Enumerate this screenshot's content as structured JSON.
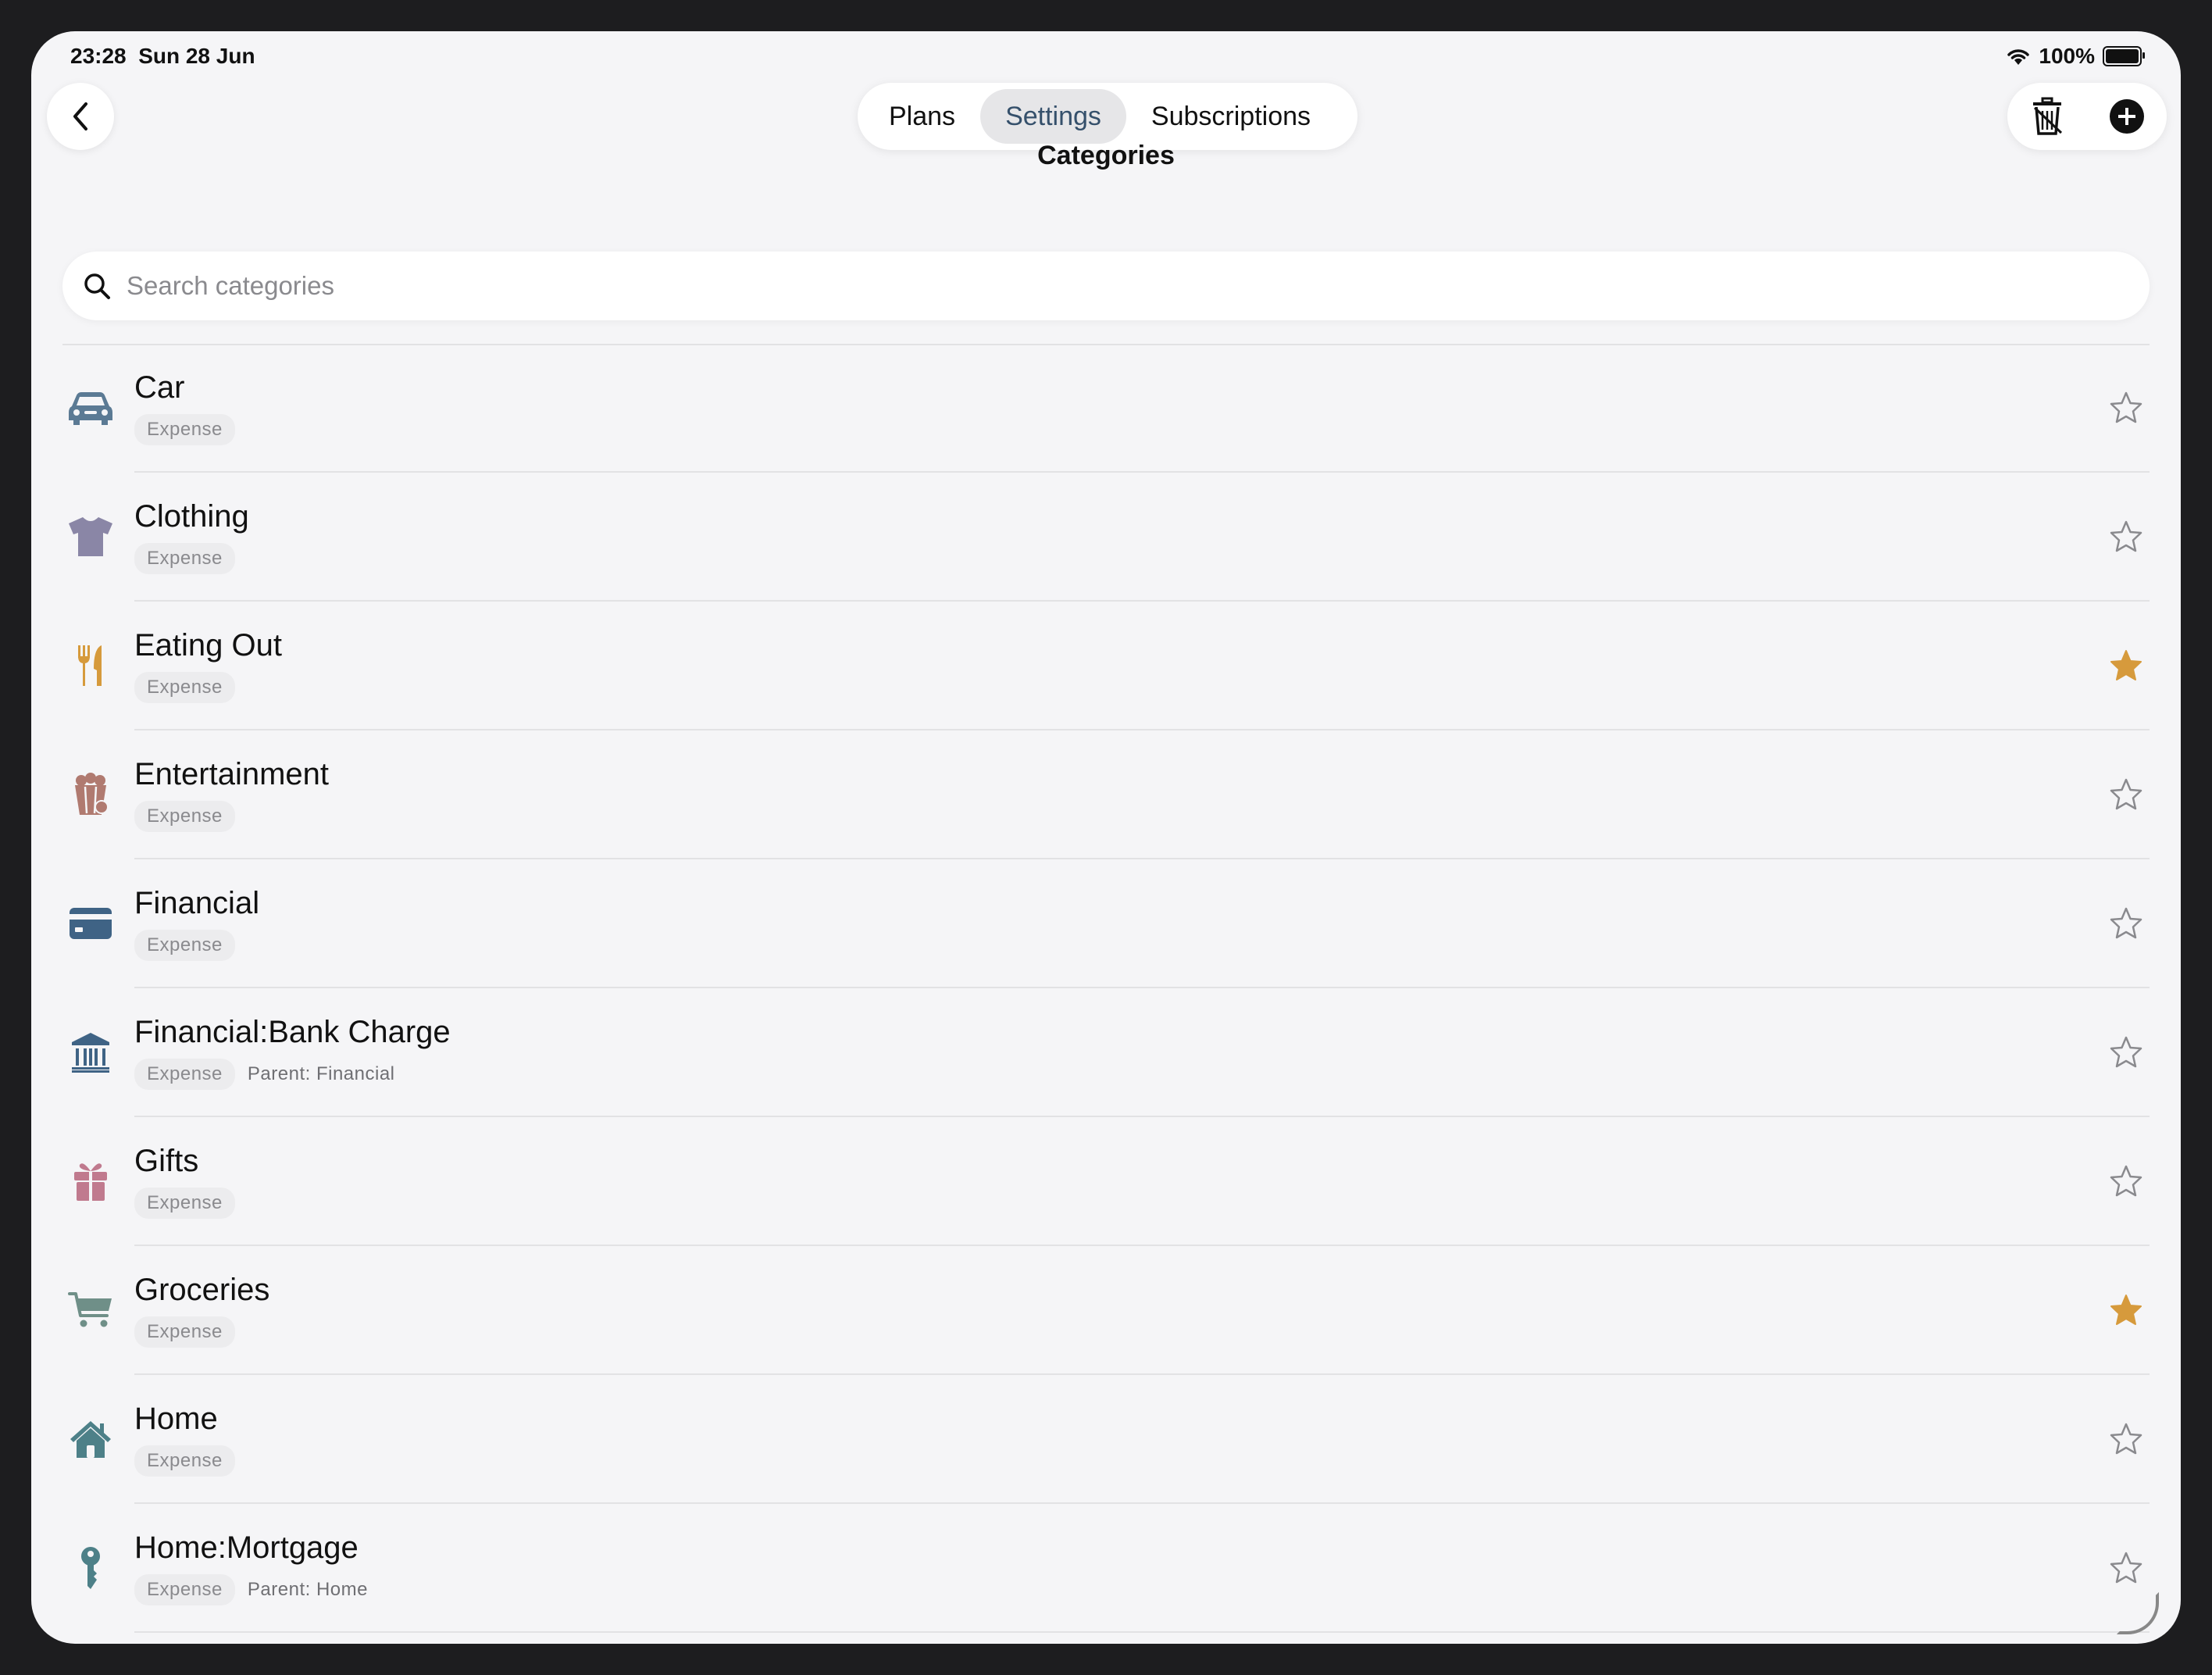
{
  "status_bar": {
    "time": "23:28",
    "date": "Sun 28 Jun",
    "battery": "100%"
  },
  "nav": {
    "back_icon": "chevron-left-icon",
    "tabs": [
      {
        "label": "Plans",
        "active": false
      },
      {
        "label": "Settings",
        "active": true
      },
      {
        "label": "Subscriptions",
        "active": false
      }
    ],
    "actions": [
      "trash-icon",
      "plus-circle-icon"
    ]
  },
  "page": {
    "title": "Categories"
  },
  "search": {
    "placeholder": "Search categories",
    "value": ""
  },
  "categories": [
    {
      "name": "Car",
      "type": "Expense",
      "parent": "",
      "icon": "car-icon",
      "icon_color": "#5b7a94",
      "favorite": false
    },
    {
      "name": "Clothing",
      "type": "Expense",
      "parent": "",
      "icon": "shirt-icon",
      "icon_color": "#8a86a6",
      "favorite": false
    },
    {
      "name": "Eating Out",
      "type": "Expense",
      "parent": "",
      "icon": "fork-knife-icon",
      "icon_color": "#d69a3c",
      "favorite": true
    },
    {
      "name": "Entertainment",
      "type": "Expense",
      "parent": "",
      "icon": "popcorn-icon",
      "icon_color": "#b07a70",
      "favorite": false
    },
    {
      "name": "Financial",
      "type": "Expense",
      "parent": "",
      "icon": "credit-card-icon",
      "icon_color": "#3f6385",
      "favorite": false
    },
    {
      "name": "Financial:Bank Charge",
      "type": "Expense",
      "parent": "Parent: Financial",
      "icon": "bank-icon",
      "icon_color": "#3f6385",
      "favorite": false
    },
    {
      "name": "Gifts",
      "type": "Expense",
      "parent": "",
      "icon": "gift-icon",
      "icon_color": "#c07a8e",
      "favorite": false
    },
    {
      "name": "Groceries",
      "type": "Expense",
      "parent": "",
      "icon": "cart-icon",
      "icon_color": "#6f8f88",
      "favorite": true
    },
    {
      "name": "Home",
      "type": "Expense",
      "parent": "",
      "icon": "house-icon",
      "icon_color": "#4d8088",
      "favorite": false
    },
    {
      "name": "Home:Mortgage",
      "type": "Expense",
      "parent": "Parent: Home",
      "icon": "key-icon",
      "icon_color": "#4d8088",
      "favorite": false
    }
  ],
  "colors": {
    "accent": "#35506b",
    "favorite_star": "#d69a3c",
    "star_outline": "#8a8a8e"
  }
}
